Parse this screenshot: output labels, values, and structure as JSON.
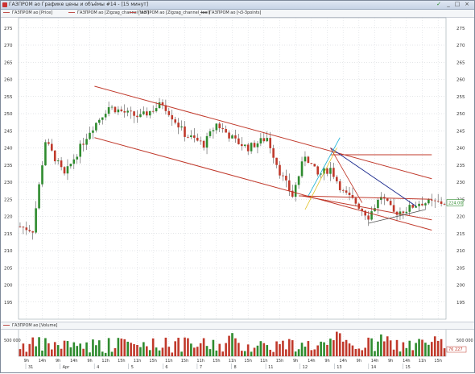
{
  "window": {
    "title": "ГАЗПРОМ ао Графике цены и объёмы #14 - [15 минут]"
  },
  "legend": {
    "items": [
      {
        "label": "ГАЗПРОМ ао [Price]",
        "color": "#c0504d"
      },
      {
        "label": "ГАЗПРОМ ао [Zigzag_channel_tool]",
        "color": "#c0504d"
      },
      {
        "label": "ГАЗПРОМ ао [Zigzag_channel_tool]",
        "color": "#c0504d"
      },
      {
        "label": "ГАЗПРОМ ао [ч3-3points]",
        "color": "#555555"
      }
    ]
  },
  "volume_legend": {
    "label": "ГАЗПРОМ ао [Volume]",
    "color": "#c0504d"
  },
  "price_axis": {
    "ticks": [
      "275",
      "270",
      "265",
      "260",
      "255",
      "250",
      "245",
      "240",
      "235",
      "230",
      "225",
      "220",
      "215",
      "210",
      "205",
      "200",
      "195"
    ],
    "current_price": "224.00"
  },
  "volume_axis": {
    "ticks": [
      "500 000",
      "500 000"
    ],
    "current_volume": "76 227"
  },
  "time_axis": {
    "time_labels": [
      "9h",
      "14h",
      "9h",
      "14h",
      "9h",
      "12h",
      "15h",
      "11h",
      "15h",
      "11h",
      "15h",
      "11h",
      "15h",
      "11h",
      "15h",
      "11h",
      "15h",
      "9h",
      "14h",
      "9h",
      "14h",
      "9h",
      "14h",
      "9h",
      "14h",
      "11h",
      "15h"
    ],
    "date_labels": [
      "31",
      "Apr",
      "4",
      "5",
      "6",
      "7",
      "8",
      "11",
      "12",
      "13",
      "14",
      "15"
    ]
  },
  "chart_data": {
    "type": "candlestick",
    "ylim": [
      190,
      278
    ],
    "grid": true,
    "key_points": {
      "x_index": [
        0,
        4,
        8,
        14,
        22,
        28,
        34,
        38,
        45,
        52,
        58,
        62,
        68,
        72,
        78,
        82,
        86,
        90,
        94,
        98,
        102,
        106,
        110,
        114,
        118,
        122,
        126,
        130
      ],
      "close": [
        217,
        216,
        242,
        232,
        245,
        252,
        250,
        249,
        253,
        244,
        241,
        247,
        242,
        240,
        243,
        233,
        226,
        238,
        232,
        234,
        227,
        224,
        220,
        226,
        221,
        222,
        224,
        224
      ]
    },
    "channel_lines": [
      {
        "from": [
          23.5,
          258
        ],
        "to": [
          130,
          231
        ],
        "color": "#c0392b"
      },
      {
        "from": [
          23.5,
          243
        ],
        "to": [
          130,
          216
        ],
        "color": "#c0392b"
      },
      {
        "from": [
          98,
          238
        ],
        "to": [
          130,
          238
        ],
        "color": "#c0392b"
      },
      {
        "from": [
          88,
          226
        ],
        "to": [
          130,
          225
        ],
        "color": "#c0392b"
      },
      {
        "from": [
          89,
          226
        ],
        "to": [
          130,
          219
        ],
        "color": "#c0392b"
      },
      {
        "from": [
          98,
          240
        ],
        "to": [
          125,
          223
        ],
        "color": "#1f2e8f"
      }
    ]
  }
}
